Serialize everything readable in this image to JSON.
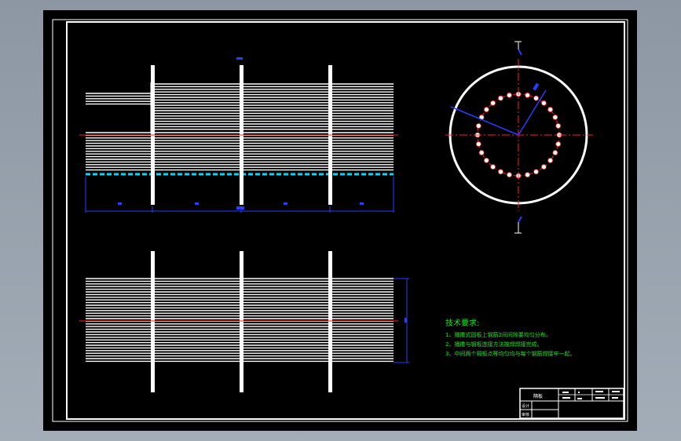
{
  "drawing": {
    "notes_title": "技术要求:",
    "notes": [
      "1、播撒式固板上钢筋2间间隙要均匀分布。",
      "2、播撒与钢板连接方法按焊焊接完成。",
      "3、中间两个隔板点等均匀均与每个钢筋焊接牢一起。"
    ],
    "title_block": {
      "part_name": "隔板",
      "designer_label": "设计",
      "checker_label": "审核"
    }
  },
  "colors": {
    "background": "#000000",
    "outline": "#ffffff",
    "centerline": "#ff2020",
    "dimension": "#2a3cff",
    "weld": "#00d8ff",
    "notes": "#21e221"
  }
}
